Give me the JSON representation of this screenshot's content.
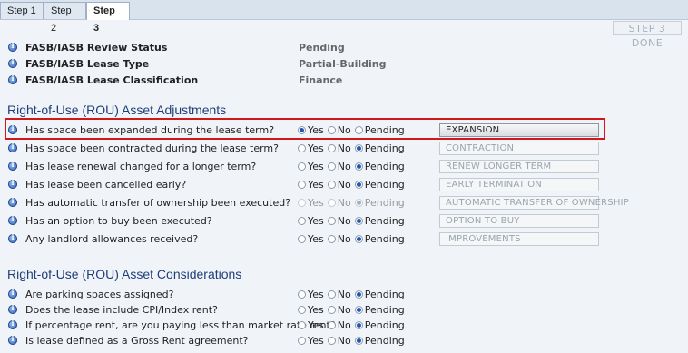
{
  "tabs": [
    "Step 1",
    "Step 2",
    "Step 3"
  ],
  "active_tab": "Step 3",
  "done_label": "STEP 3 DONE",
  "status_rows": [
    {
      "label": "FASB/IASB Review Status",
      "value": "Pending"
    },
    {
      "label": "FASB/IASB Lease Type",
      "value": "Partial-Building"
    },
    {
      "label": "FASB/IASB Lease Classification",
      "value": "Finance"
    }
  ],
  "adjustments": {
    "title": "Right-of-Use (ROU) Asset Adjustments",
    "rows": [
      {
        "question": "Has space been expanded during the lease term?",
        "selected": "Yes",
        "disabled": false,
        "button": "EXPANSION",
        "button_active": true
      },
      {
        "question": "Has space been contracted during the lease term?",
        "selected": "Pending",
        "disabled": false,
        "button": "CONTRACTION",
        "button_active": false
      },
      {
        "question": "Has lease renewal changed for a longer term?",
        "selected": "Pending",
        "disabled": false,
        "button": "RENEW LONGER TERM",
        "button_active": false
      },
      {
        "question": "Has lease been cancelled early?",
        "selected": "Pending",
        "disabled": false,
        "button": "EARLY TERMINATION",
        "button_active": false
      },
      {
        "question": "Has automatic transfer of ownership been executed?",
        "selected": "Pending",
        "disabled": true,
        "button": "AUTOMATIC TRANSFER OF OWNERSHIP",
        "button_active": false
      },
      {
        "question": "Has an option to buy been executed?",
        "selected": "Pending",
        "disabled": false,
        "button": "OPTION TO BUY",
        "button_active": false
      },
      {
        "question": "Any landlord allowances received?",
        "selected": "Pending",
        "disabled": false,
        "button": "IMPROVEMENTS",
        "button_active": false
      }
    ]
  },
  "considerations": {
    "title": "Right-of-Use (ROU) Asset Considerations",
    "rows": [
      {
        "question": "Are parking spaces assigned?",
        "selected": "Pending"
      },
      {
        "question": "Does the lease include CPI/Index rent?",
        "selected": "Pending"
      },
      {
        "question": "If percentage rent, are you paying less than market rate rent?",
        "selected": "Pending"
      },
      {
        "question": "Is lease defined as a Gross Rent agreement?",
        "selected": "Pending"
      }
    ]
  },
  "radio_options": [
    "Yes",
    "No",
    "Pending"
  ],
  "colors": {
    "section_title": "#1f3f78",
    "highlight": "#d01818",
    "radio_selected": "#1f55b8"
  }
}
